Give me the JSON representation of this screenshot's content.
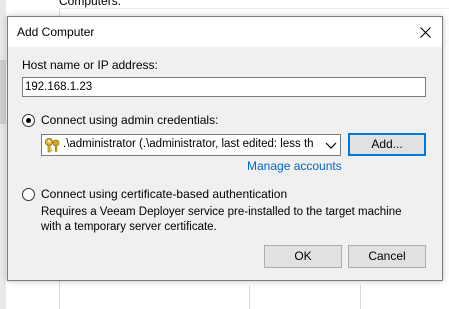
{
  "background": {
    "label": "Computers:"
  },
  "dialog": {
    "title": "Add Computer",
    "host_label": "Host name or IP address:",
    "host_value": "192.168.1.23",
    "option_admin": {
      "label": "Connect using admin credentials:",
      "selected": true
    },
    "credentials_combo": {
      "icon": "key-icon",
      "value": ".\\administrator (.\\administrator, last edited: less th"
    },
    "add_button": "Add...",
    "manage_link": "Manage accounts",
    "option_cert": {
      "label": "Connect using certificate-based authentication",
      "selected": false,
      "desc_line1": "Requires a Veeam Deployer service pre-installed to the target machine",
      "desc_line2": "with a temporary server certificate."
    },
    "ok_button": "OK",
    "cancel_button": "Cancel"
  },
  "colors": {
    "dialog_bg": "#f0f0f0",
    "link": "#0066cc",
    "focus_border": "#0078d7"
  }
}
